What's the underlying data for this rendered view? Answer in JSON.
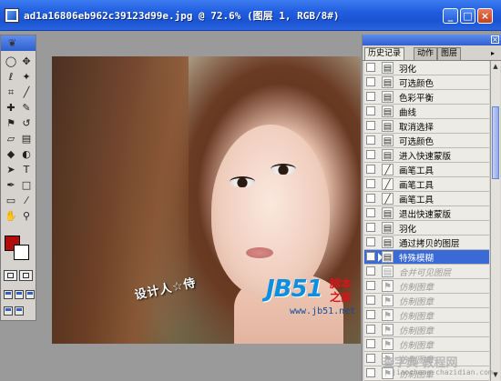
{
  "window": {
    "title": "ad1a16806eb962c39123d99e.jpg @ 72.6% (图层 1, RGB/8#)",
    "minimize": "_",
    "maximize": "□",
    "close": "×"
  },
  "toolbox": {
    "tools": [
      {
        "name": "marquee-icon",
        "glyph": "◯"
      },
      {
        "name": "move-icon",
        "glyph": "✥"
      },
      {
        "name": "lasso-icon",
        "glyph": "ℓ"
      },
      {
        "name": "magic-wand-icon",
        "glyph": "✦"
      },
      {
        "name": "crop-icon",
        "glyph": "⌗"
      },
      {
        "name": "slice-icon",
        "glyph": "╱"
      },
      {
        "name": "healing-brush-icon",
        "glyph": "✚"
      },
      {
        "name": "brush-icon",
        "glyph": "✎"
      },
      {
        "name": "clone-stamp-icon",
        "glyph": "⚑"
      },
      {
        "name": "history-brush-icon",
        "glyph": "↺"
      },
      {
        "name": "eraser-icon",
        "glyph": "▱"
      },
      {
        "name": "gradient-icon",
        "glyph": "▤"
      },
      {
        "name": "blur-icon",
        "glyph": "◆"
      },
      {
        "name": "dodge-icon",
        "glyph": "◐"
      },
      {
        "name": "path-select-icon",
        "glyph": "➤"
      },
      {
        "name": "type-icon",
        "glyph": "T"
      },
      {
        "name": "pen-icon",
        "glyph": "✒"
      },
      {
        "name": "shape-icon",
        "glyph": "□"
      },
      {
        "name": "notes-icon",
        "glyph": "▭"
      },
      {
        "name": "eyedropper-icon",
        "glyph": "⁄"
      },
      {
        "name": "hand-icon",
        "glyph": "✋"
      },
      {
        "name": "zoom-icon",
        "glyph": "⚲"
      }
    ],
    "foreground_color": "#b00d0d",
    "background_color": "#ffffff"
  },
  "canvas": {
    "design_watermark": "设计人☆侍",
    "logo_text": "JB51",
    "logo_cn_line1": "脚本",
    "logo_cn_line2": "之家",
    "logo_url": "www.jb51.net"
  },
  "panel": {
    "tabs": [
      "历史记录",
      "动作",
      "图层"
    ],
    "active_tab": 0,
    "menu_glyph": "▸",
    "close": "×",
    "items": [
      {
        "label": "羽化",
        "icon": "▤",
        "state": "normal"
      },
      {
        "label": "可选颜色",
        "icon": "▤",
        "state": "normal"
      },
      {
        "label": "色彩平衡",
        "icon": "▤",
        "state": "normal"
      },
      {
        "label": "曲线",
        "icon": "▤",
        "state": "normal"
      },
      {
        "label": "取消选择",
        "icon": "▤",
        "state": "normal"
      },
      {
        "label": "可选颜色",
        "icon": "▤",
        "state": "normal"
      },
      {
        "label": "进入快速蒙版",
        "icon": "▤",
        "state": "normal"
      },
      {
        "label": "画笔工具",
        "icon": "╱",
        "state": "normal"
      },
      {
        "label": "画笔工具",
        "icon": "╱",
        "state": "normal"
      },
      {
        "label": "画笔工具",
        "icon": "╱",
        "state": "normal"
      },
      {
        "label": "退出快速蒙版",
        "icon": "▤",
        "state": "normal"
      },
      {
        "label": "羽化",
        "icon": "▤",
        "state": "normal"
      },
      {
        "label": "通过拷贝的图层",
        "icon": "▤",
        "state": "normal"
      },
      {
        "label": "特殊模糊",
        "icon": "▤",
        "state": "selected"
      },
      {
        "label": "合并可见图层",
        "icon": "▤",
        "state": "ghost"
      },
      {
        "label": "仿制图章",
        "icon": "⚑",
        "state": "ghost"
      },
      {
        "label": "仿制图章",
        "icon": "⚑",
        "state": "ghost"
      },
      {
        "label": "仿制图章",
        "icon": "⚑",
        "state": "ghost"
      },
      {
        "label": "仿制图章",
        "icon": "⚑",
        "state": "ghost"
      },
      {
        "label": "仿制图章",
        "icon": "⚑",
        "state": "ghost"
      },
      {
        "label": "仿制图章",
        "icon": "⚑",
        "state": "ghost"
      },
      {
        "label": "仿制图章",
        "icon": "⚑",
        "state": "ghost"
      }
    ]
  },
  "footer": {
    "site_watermark": "查字典 教程网",
    "site_url": "jiaocheng.chazidian.com"
  }
}
